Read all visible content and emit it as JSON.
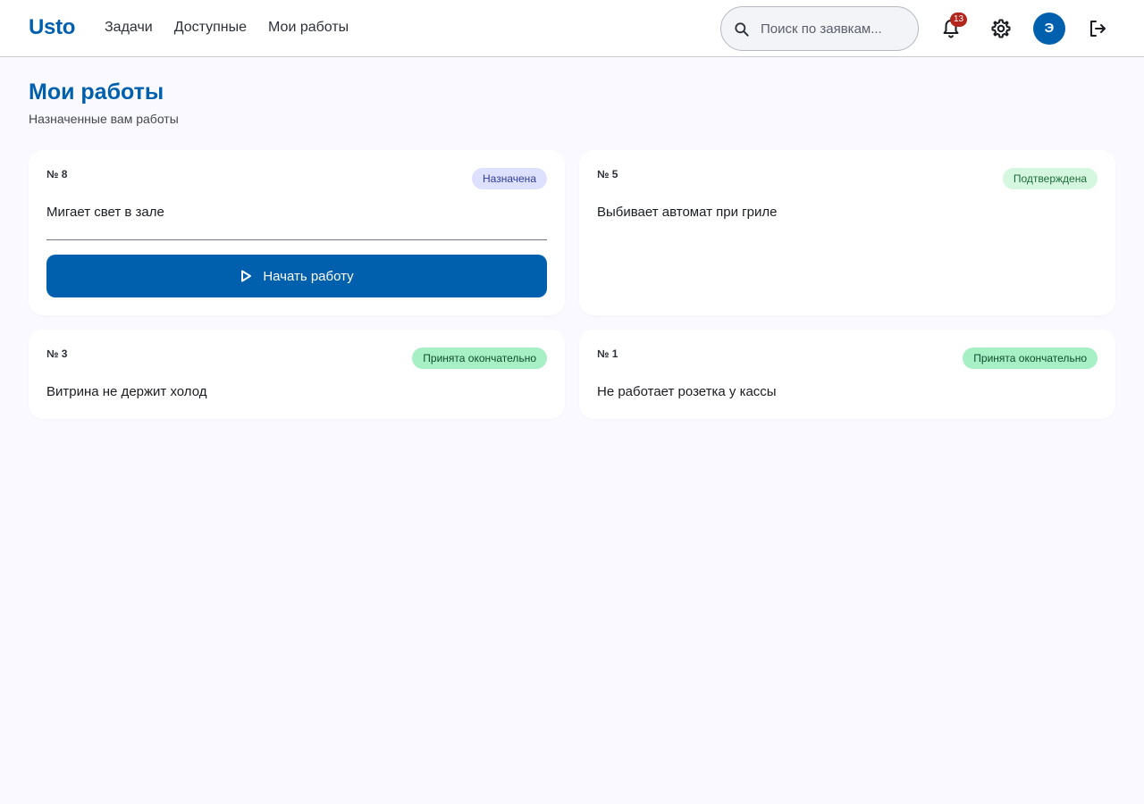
{
  "header": {
    "brand": "Usto",
    "nav": [
      {
        "label": "Задачи"
      },
      {
        "label": "Доступные"
      },
      {
        "label": "Мои работы"
      }
    ],
    "search": {
      "placeholder": "Поиск по заявкам...",
      "value": "",
      "icon": "search-icon"
    },
    "notifications": {
      "icon": "bell-icon",
      "count": "13"
    },
    "settings": {
      "icon": "gear-icon"
    },
    "avatar": {
      "initial": "Э"
    },
    "logout": {
      "icon": "logout-icon"
    }
  },
  "main": {
    "title": "Мои работы",
    "subtitle": "Назначенные вам работы",
    "cards": [
      {
        "number": "№ 8",
        "status": "Назначена",
        "description": "Мигает свет в зале",
        "action": {
          "label": "Начать работу",
          "icon": "play-icon"
        }
      },
      {
        "number": "№ 5",
        "status": "Подтверждена",
        "description": "Выбивает автомат при гриле"
      },
      {
        "number": "№ 3",
        "status": "Принята окончательно",
        "description": "Витрина не держит холод"
      },
      {
        "number": "№ 1",
        "status": "Принята окончательно",
        "description": "Не работает розетка у кассы"
      }
    ]
  },
  "colors": {
    "accent": "#0060ad",
    "background": "#f9f9ff",
    "badge": "#b3261e",
    "chip_assigned": "#dde1ff",
    "chip_confirmed": "#d5f7e0",
    "chip_accepted": "#a7f0c6"
  }
}
